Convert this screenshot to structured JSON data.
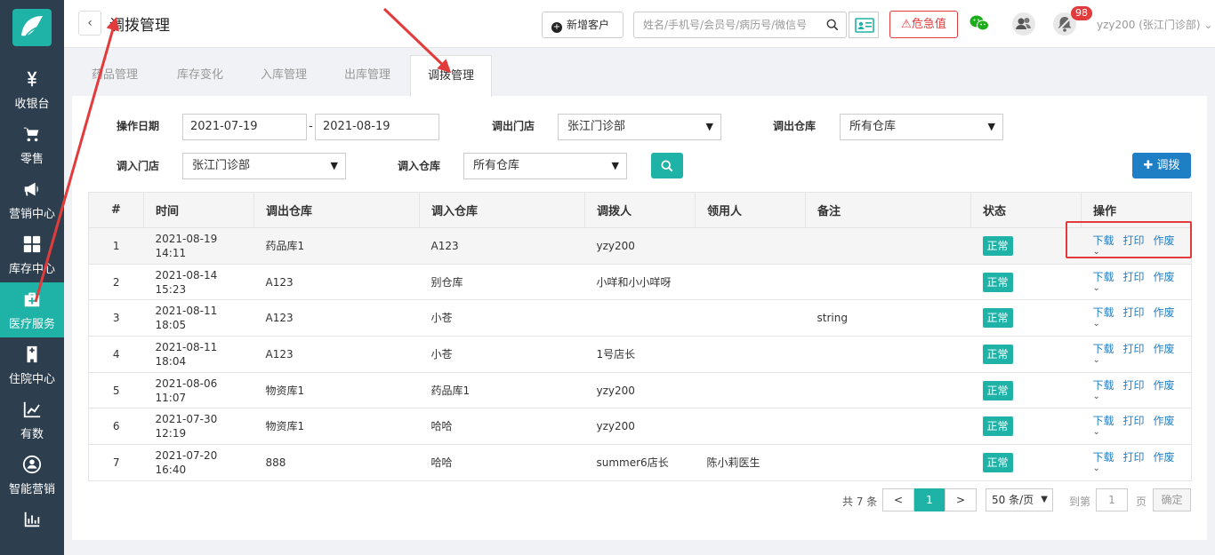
{
  "sidebar": {
    "items": [
      {
        "label": "收银台",
        "icon": "yen-icon"
      },
      {
        "label": "零售",
        "icon": "cart-icon"
      },
      {
        "label": "营销中心",
        "icon": "megaphone-icon"
      },
      {
        "label": "库存中心",
        "icon": "grid-icon"
      },
      {
        "label": "医疗服务",
        "icon": "medical-kit-icon",
        "active": true
      },
      {
        "label": "住院中心",
        "icon": "hospital-icon"
      },
      {
        "label": "有数",
        "icon": "trend-chart-icon"
      },
      {
        "label": "智能营销",
        "icon": "smart-marketing-icon"
      },
      {
        "label": "",
        "icon": "bar-chart-icon"
      }
    ]
  },
  "header": {
    "back": "‹",
    "title": "调拨管理",
    "new_customer": "新增客户",
    "search_placeholder": "姓名/手机号/会员号/病历号/微信号",
    "danger_value": "危急值",
    "notification_count": "98",
    "user": "yzy200 (张江门诊部)"
  },
  "tabs": [
    "药品管理",
    "库存变化",
    "入库管理",
    "出库管理",
    "调拨管理"
  ],
  "active_tab": "调拨管理",
  "filters": {
    "date_label": "操作日期",
    "date_from": "2021-07-19",
    "date_sep": "-",
    "date_to": "2021-08-19",
    "out_store_label": "调出门店",
    "out_store": "张江门诊部",
    "out_warehouse_label": "调出仓库",
    "out_warehouse": "所有仓库",
    "in_store_label": "调入门店",
    "in_store": "张江门诊部",
    "in_warehouse_label": "调入仓库",
    "in_warehouse": "所有仓库",
    "add_button": "调拨"
  },
  "table": {
    "columns": [
      "#",
      "时间",
      "调出仓库",
      "调入仓库",
      "调拨人",
      "领用人",
      "备注",
      "状态",
      "操作"
    ],
    "rows": [
      {
        "no": "1",
        "date": "2021-08-19",
        "time": "14:11",
        "out": "药品库1",
        "in": "A123",
        "operator": "yzy200",
        "receiver": "",
        "note": "",
        "status": "正常"
      },
      {
        "no": "2",
        "date": "2021-08-14",
        "time": "15:23",
        "out": "A123",
        "in": "别仓库",
        "operator": "小咩和小小咩呀",
        "receiver": "",
        "note": "",
        "status": "正常"
      },
      {
        "no": "3",
        "date": "2021-08-11",
        "time": "18:05",
        "out": "A123",
        "in": "小苍",
        "operator": "",
        "receiver": "",
        "note": "string",
        "status": "正常"
      },
      {
        "no": "4",
        "date": "2021-08-11",
        "time": "18:04",
        "out": "A123",
        "in": "小苍",
        "operator": "1号店长",
        "receiver": "",
        "note": "",
        "status": "正常"
      },
      {
        "no": "5",
        "date": "2021-08-06",
        "time": "11:07",
        "out": "物资库1",
        "in": "药品库1",
        "operator": "yzy200",
        "receiver": "",
        "note": "",
        "status": "正常"
      },
      {
        "no": "6",
        "date": "2021-07-30",
        "time": "12:19",
        "out": "物资库1",
        "in": "哈哈",
        "operator": "yzy200",
        "receiver": "",
        "note": "",
        "status": "正常"
      },
      {
        "no": "7",
        "date": "2021-07-20",
        "time": "16:40",
        "out": "888",
        "in": "哈哈",
        "operator": "summer6店长",
        "receiver": "陈小莉医生",
        "note": "",
        "status": "正常"
      }
    ],
    "actions": [
      "下载",
      "打印",
      "作废"
    ]
  },
  "pager": {
    "total": "共 7 条",
    "prev": "<",
    "current": "1",
    "next": ">",
    "page_size": "50 条/页",
    "goto_label": "到第",
    "goto_value": "1",
    "page_unit": "页",
    "confirm": "确定"
  },
  "colors": {
    "accent": "#1fb3a8",
    "primary": "#1e7fc5",
    "danger": "#e23b3b",
    "sidebar": "#2d3e4e"
  }
}
